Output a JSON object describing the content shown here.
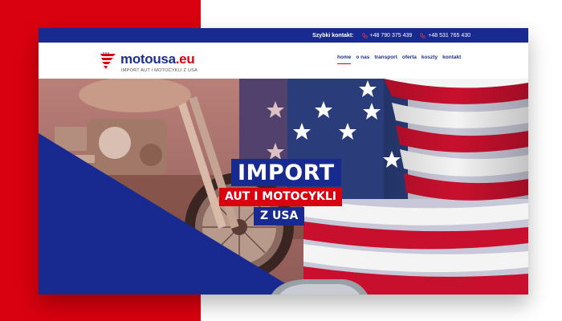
{
  "topbar": {
    "quick_contact_label": "Szybki kontakt:",
    "phones": [
      "+48 790 375 439",
      "+48 531 765 430"
    ]
  },
  "logo": {
    "name_main": "motousa",
    "name_ext": ".eu",
    "tagline": "IMPORT AUT I MOTOCYKLI Z USA"
  },
  "nav": {
    "items": [
      "home",
      "o nas",
      "transport",
      "oferta",
      "koszty",
      "kontakt"
    ],
    "active": "home"
  },
  "hero": {
    "line1": "IMPORT",
    "line2": "AUT I MOTOCYKLI",
    "line3": "Z USA"
  },
  "colors": {
    "brand_blue": "#182a8f",
    "brand_red": "#d9000f"
  }
}
